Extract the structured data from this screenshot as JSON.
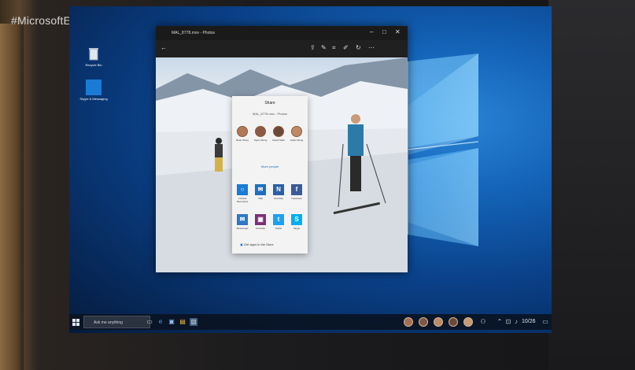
{
  "overlay": {
    "hashtag": "#MicrosoftEvent"
  },
  "desktop": {
    "icons": [
      {
        "label": "Recycle Bin",
        "icon": "recycle-bin-icon"
      },
      {
        "label": "Skype & Messaging",
        "icon": "app-tile-icon"
      }
    ]
  },
  "photos_window": {
    "title": "MAL_8778.mov - Photos",
    "toolbar_icons": [
      "share-icon",
      "edit-icon",
      "crop-icon",
      "draw-icon",
      "rotate-icon",
      "more-icon"
    ],
    "caption_buttons": [
      "minimize",
      "maximize",
      "close"
    ]
  },
  "share_panel": {
    "title": "Share",
    "subtitle": "MAL_8778.mov - Photos",
    "people": [
      {
        "name": "Brian Wong"
      },
      {
        "name": "Taylor Wong"
      },
      {
        "name": "David Shah"
      },
      {
        "name": "Julian Wong"
      }
    ],
    "more_people": "More people",
    "apps": [
      {
        "label": "Cortana Reminders",
        "glyph": "○",
        "color": "#1a7bd4"
      },
      {
        "label": "Mail",
        "glyph": "✉",
        "color": "#1e6fc0"
      },
      {
        "label": "OneNote",
        "glyph": "N",
        "color": "#2a5ea8"
      },
      {
        "label": "Facebook",
        "glyph": "f",
        "color": "#3b5a98"
      },
      {
        "label": "Messenger",
        "glyph": "✉",
        "color": "#2f78c4"
      },
      {
        "label": "OneNote",
        "glyph": "▣",
        "color": "#7b2f7a"
      },
      {
        "label": "Twitter",
        "glyph": "t",
        "color": "#1da1f2"
      },
      {
        "label": "Skype",
        "glyph": "S",
        "color": "#00aff0"
      }
    ],
    "store_link": "Get apps in the Store"
  },
  "taskbar": {
    "search_placeholder": "Ask me anything",
    "pinned_apps": [
      "task-view-icon",
      "edge-icon",
      "store-icon",
      "file-explorer-icon",
      "photos-icon"
    ],
    "people_count": 5,
    "tray_icons": [
      "people-icon",
      "chevron-up-icon",
      "network-icon",
      "volume-icon"
    ],
    "clock": "10/26",
    "notification_icon": "action-center-icon"
  },
  "colors": {
    "accent": "#1a7bd4",
    "desktop_blue": "#0a3f86",
    "taskbar": "#0a1423"
  }
}
